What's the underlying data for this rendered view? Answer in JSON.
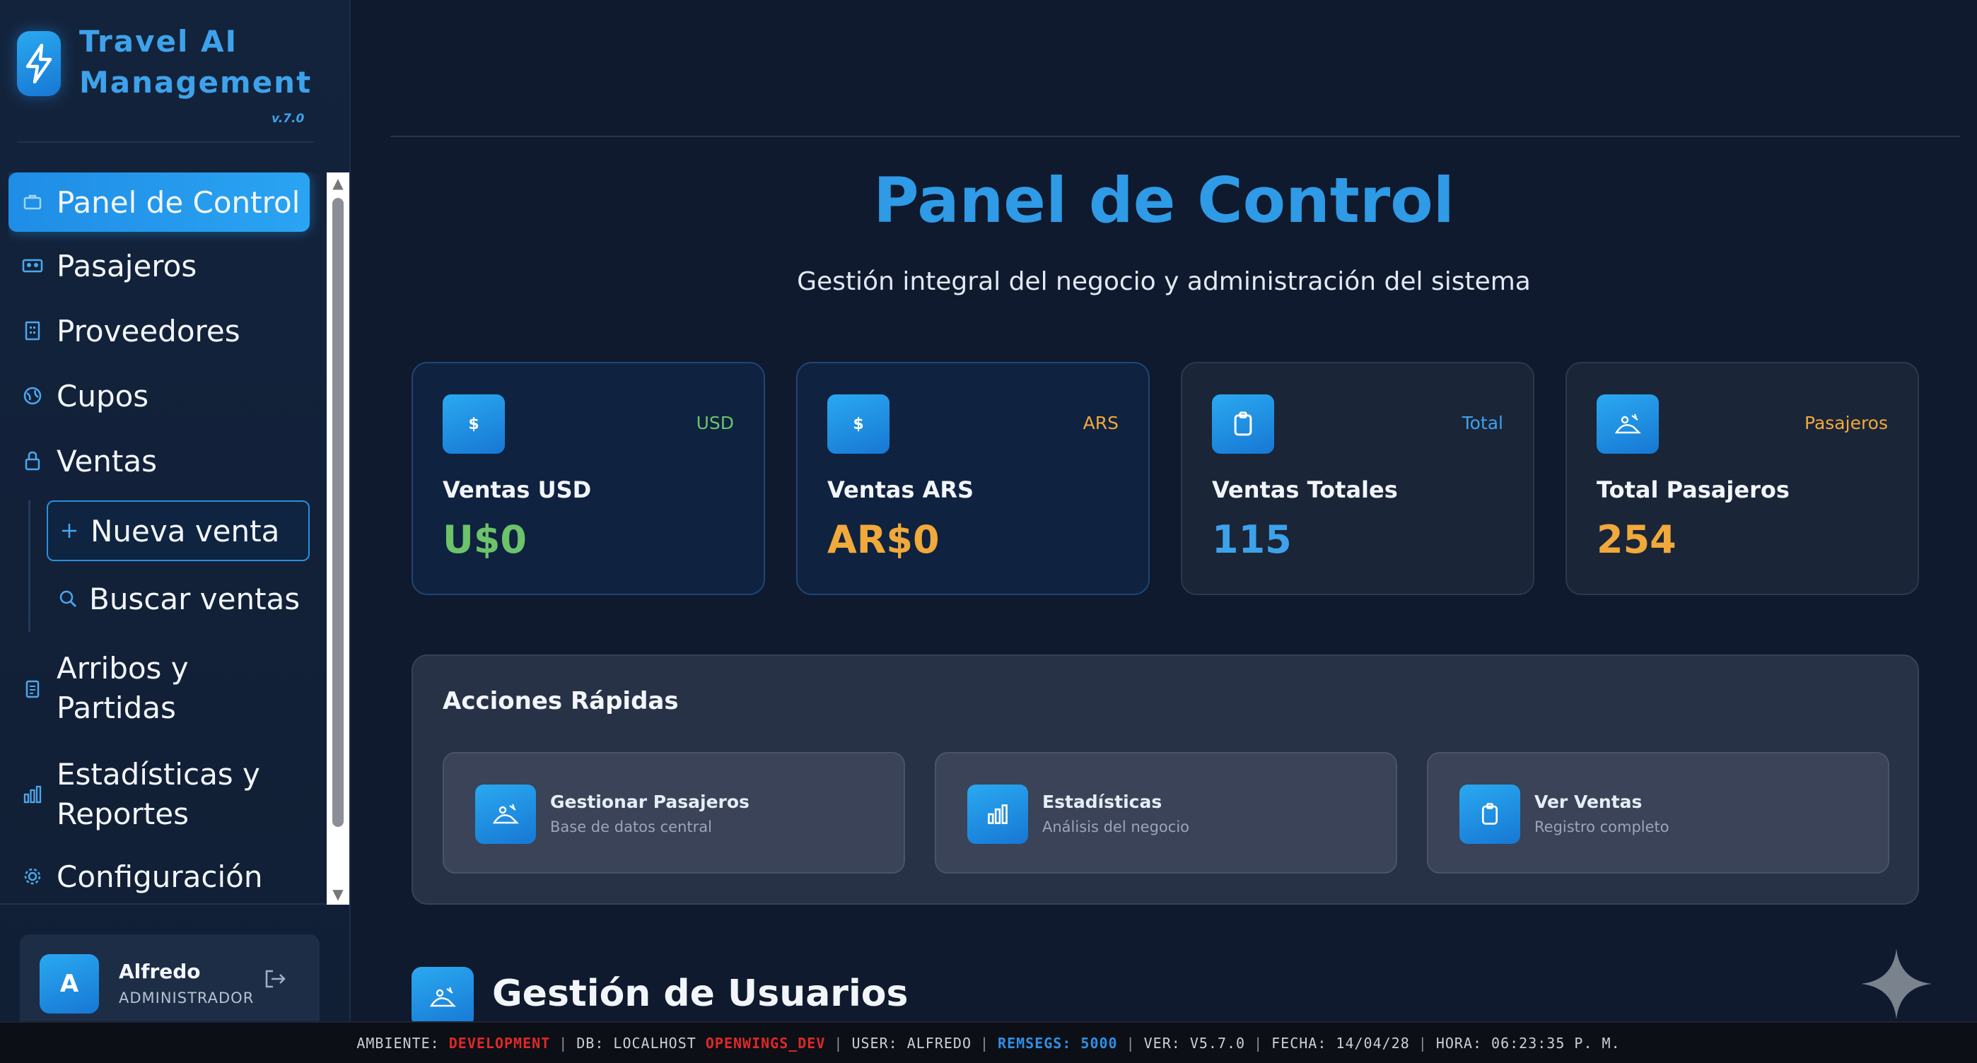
{
  "brand": {
    "title_line1": "Travel AI",
    "title_line2": "Management",
    "version": "v.7.0"
  },
  "sidebar": {
    "items": [
      {
        "label": "Panel de Control",
        "icon": "dashboard-icon",
        "active": true
      },
      {
        "label": "Pasajeros",
        "icon": "passengers-icon"
      },
      {
        "label": "Proveedores",
        "icon": "building-icon"
      },
      {
        "label": "Cupos",
        "icon": "globe-icon"
      },
      {
        "label": "Ventas",
        "icon": "lock-icon"
      },
      {
        "label": "Arribos y Partidas",
        "icon": "clipboard-icon"
      },
      {
        "label": "Estadísticas y Reportes",
        "icon": "bar-chart-icon"
      },
      {
        "label": "Configuración",
        "icon": "gear-icon"
      }
    ],
    "sub_items": [
      {
        "label": "Nueva venta",
        "icon": "plus-icon"
      },
      {
        "label": "Buscar ventas",
        "icon": "search-icon"
      }
    ],
    "user": {
      "initial": "A",
      "name": "Alfredo",
      "role": "ADMINISTRADOR"
    }
  },
  "main": {
    "title": "Panel de Control",
    "subtitle": "Gestión integral del negocio y administración del sistema",
    "stats": [
      {
        "icon_text": "$",
        "tag": "USD",
        "label": "Ventas USD",
        "value": "U$0",
        "tag_color": "#6cc36a",
        "value_color": "#6cc36a"
      },
      {
        "icon_text": "$",
        "tag": "ARS",
        "label": "Ventas ARS",
        "value": "AR$0",
        "tag_color": "#f0a93a",
        "value_color": "#f0a93a"
      },
      {
        "icon_text": "",
        "tag": "Total",
        "label": "Ventas Totales",
        "value": "115",
        "tag_color": "#3ea2ea",
        "value_color": "#3ea2ea"
      },
      {
        "icon_text": "",
        "tag": "Pasajeros",
        "label": "Total Pasajeros",
        "value": "254",
        "tag_color": "#f0a93a",
        "value_color": "#f0a93a"
      }
    ],
    "quick_actions": {
      "title": "Acciones Rápidas",
      "items": [
        {
          "label": "Gestionar Pasajeros",
          "desc": "Base de datos central",
          "icon": "passengers-icon"
        },
        {
          "label": "Estadísticas",
          "desc": "Análisis del negocio",
          "icon": "bar-chart-icon"
        },
        {
          "label": "Ver Ventas",
          "desc": "Registro completo",
          "icon": "clipboard-icon"
        }
      ]
    },
    "section_title": "Gestión de Usuarios"
  },
  "status_bar": {
    "env_label": "AMBIENTE:",
    "env_value": "DEVELOPMENT",
    "db_label": "DB: LOCALHOST",
    "db_value": "OPENWINGS_DEV",
    "user": "USER: ALFREDO",
    "remsegs_label": "REMSEGS:",
    "remsegs_value": "5000",
    "version": "VER: V5.7.0",
    "date": "FECHA: 14/04/28",
    "time": "HORA: 06:23:35 P. M."
  },
  "colors": {
    "accent": "#2a9ae8",
    "background": "#0f1a2e",
    "usd": "#6cc36a",
    "ars": "#f0a93a",
    "status_red": "#e02828"
  }
}
